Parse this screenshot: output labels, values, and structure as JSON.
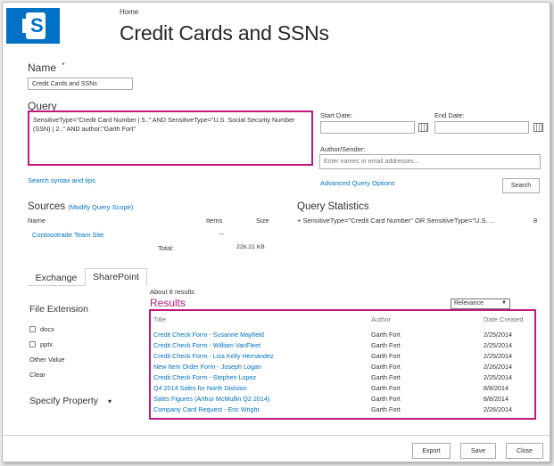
{
  "header": {
    "breadcrumb": "Home",
    "title": "Credit Cards and SSNs"
  },
  "name": {
    "label": "Name",
    "required": "*",
    "value": "Credit Cards and SSNs"
  },
  "query": {
    "label": "Query",
    "value": "SensitiveType=\"Credit Card Number | 5..\" AND SensitiveType=\"U.S. Social Security Number (SSN) | 2..\" AND author:\"Garth Fort\"",
    "syntax_link": "Search syntax and tips"
  },
  "filters": {
    "start_date_label": "Start Date:",
    "end_date_label": "End Date:",
    "author_label": "Author/Sender:",
    "author_placeholder": "Enter names or email addresses...",
    "advanced_link": "Advanced Query Options",
    "search_button": "Search"
  },
  "sources": {
    "title": "Sources",
    "modify_link": "(Modify Query Scope)",
    "columns": [
      "Name",
      "Items",
      "Size"
    ],
    "rows": [
      {
        "name": "Contosotrade Team Site",
        "items": "--",
        "size": ""
      }
    ],
    "total_label": "Total:",
    "total_size": "226.21  KB"
  },
  "stats": {
    "title": "Query Statistics",
    "line": "+ SensitiveType=\"Credit Card Number\" OR SensitiveType=\"U.S. ...",
    "count": "8"
  },
  "tabs": [
    {
      "label": "Exchange",
      "active": false
    },
    {
      "label": "SharePoint",
      "active": true
    }
  ],
  "refiners": {
    "file_extension_title": "File Extension",
    "options": [
      "docx",
      "pptx"
    ],
    "other_value": "Other Value",
    "clear": "Clear",
    "specify_property": "Specify Property",
    "specify_caret": "▾"
  },
  "results": {
    "about": "About  8  results",
    "label": "Results",
    "sort_selected": "Relevance",
    "columns": {
      "title": "Title",
      "author": "Author",
      "date": "Date Created"
    },
    "rows": [
      {
        "title": "Credit Check Form - Susanne Mayfield",
        "author": "Garth Fort",
        "date": "2/25/2014"
      },
      {
        "title": "Credit Check Form - William VanFleet",
        "author": "Garth Fort",
        "date": "2/25/2014"
      },
      {
        "title": "Credit Check Form - Lisa Kelly Hernandez",
        "author": "Garth Fort",
        "date": "2/25/2014"
      },
      {
        "title": "New Item Order Form - Joseph Logan",
        "author": "Garth Fort",
        "date": "2/26/2014"
      },
      {
        "title": "Credit Check Form - Stephen Lopez",
        "author": "Garth Fort",
        "date": "2/25/2014"
      },
      {
        "title": "Q4 2014 Sales for North Division",
        "author": "Garth Fort",
        "date": "8/8/2014"
      },
      {
        "title": "Sales Figures (Arthur McMullin Q2 2014)",
        "author": "Garth Fort",
        "date": "8/8/2014"
      },
      {
        "title": "Company Card Request - Eric Wright",
        "author": "Garth Fort",
        "date": "2/26/2014"
      }
    ]
  },
  "footer": {
    "export": "Export",
    "save": "Save",
    "close": "Close"
  },
  "colors": {
    "brand": "#0072c6",
    "highlight": "#c0197e"
  }
}
